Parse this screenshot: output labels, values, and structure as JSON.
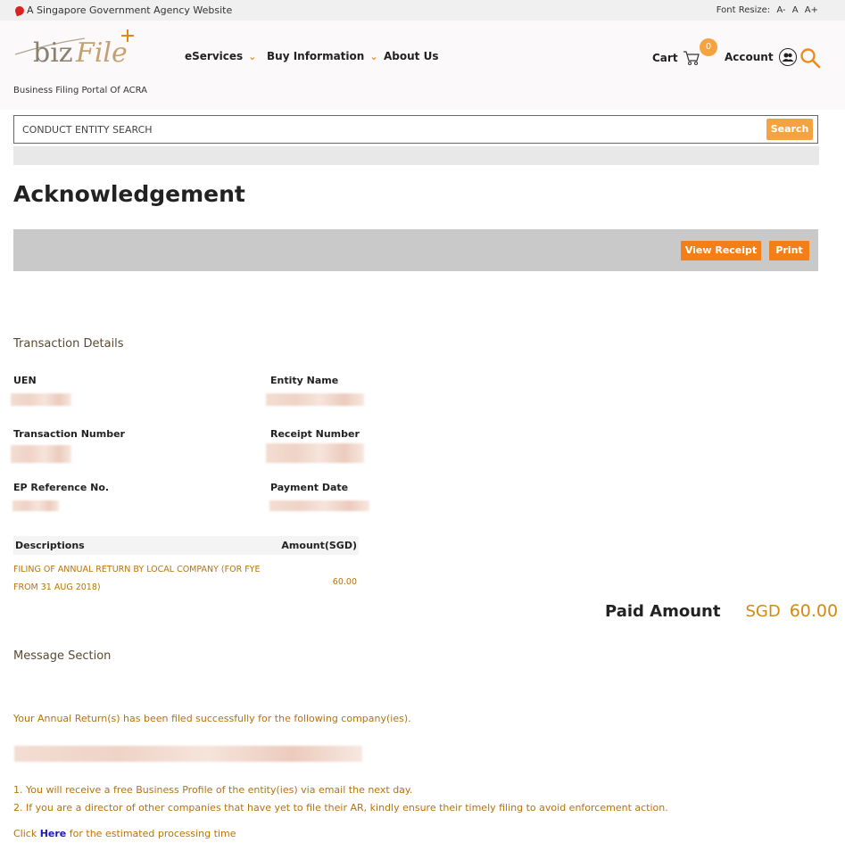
{
  "topbar": {
    "gov_text": "A Singapore Government Agency Website",
    "font_resize_label": "Font Resize:",
    "font_sizes": [
      "A-",
      "A",
      "A+"
    ]
  },
  "header": {
    "logo_text": "bizfile+",
    "tagline": "Business Filing Portal Of ACRA",
    "nav": [
      {
        "label": "eServices",
        "has_dropdown": true
      },
      {
        "label": "Buy Information",
        "has_dropdown": true
      },
      {
        "label": "About Us",
        "has_dropdown": false
      }
    ],
    "cart_label": "Cart",
    "cart_count": "0",
    "account_label": "Account"
  },
  "search": {
    "placeholder": "CONDUCT ENTITY SEARCH",
    "button_label": "Search"
  },
  "page": {
    "title": "Acknowledgement",
    "view_receipt_label": "View Receipt",
    "print_label": "Print"
  },
  "transaction": {
    "section_title": "Transaction Details",
    "fields": {
      "uen_label": "UEN",
      "entity_name_label": "Entity Name",
      "transaction_number_label": "Transaction Number",
      "receipt_number_label": "Receipt Number",
      "ep_reference_label": "EP Reference No.",
      "payment_date_label": "Payment Date"
    },
    "table": {
      "col_desc": "Descriptions",
      "col_amount": "Amount(SGD)",
      "rows": [
        {
          "description": "FILING OF ANNUAL RETURN BY LOCAL COMPANY (FOR FYE FROM 31 AUG 2018)",
          "amount": "60.00"
        }
      ]
    },
    "paid_label": "Paid Amount",
    "paid_currency": "SGD",
    "paid_amount": "60.00"
  },
  "messages": {
    "section_title": "Message Section",
    "success": "Your Annual Return(s) has been filed successfully for the following company(ies).",
    "note1": "1. You will receive a free Business Profile of the entity(ies) via email the next day.",
    "note2": "2. If you are a director of other companies that have yet to file their AR, kindly ensure their timely filing to avoid enforcement action.",
    "click_prefix": "Click ",
    "click_link": "Here",
    "click_suffix": " for the estimated processing time"
  },
  "colors": {
    "accent_orange": "#f57f17",
    "search_orange": "#f5a340",
    "text_brown": "#b8720a",
    "link_blue": "#1b1bb8"
  }
}
